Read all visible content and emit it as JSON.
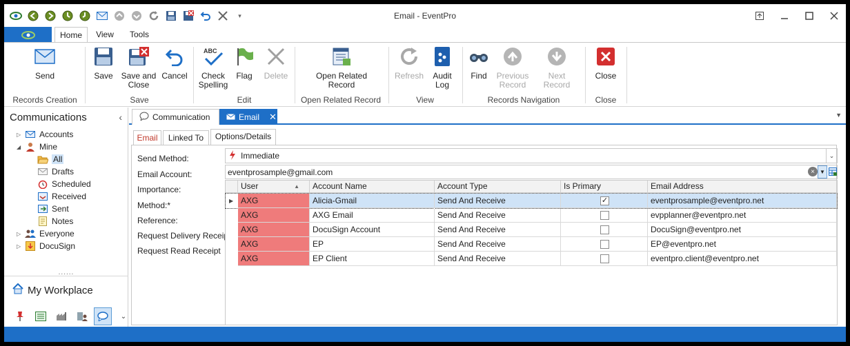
{
  "window": {
    "title": "Email - EventPro"
  },
  "qat": {
    "icons": [
      "logo-icon",
      "back-icon",
      "forward-icon",
      "home-icon",
      "clock-icon",
      "mail-icon",
      "up-icon",
      "down-icon",
      "refresh-icon",
      "save-icon",
      "save-close-icon",
      "undo-icon",
      "close-x-icon",
      "customize-icon"
    ]
  },
  "ribbon_tabs": {
    "home": "Home",
    "view": "View",
    "tools": "Tools"
  },
  "ribbon": {
    "send": "Send",
    "save": "Save",
    "save_close": "Save and Close",
    "cancel": "Cancel",
    "check_spelling": "Check Spelling",
    "flag": "Flag",
    "delete": "Delete",
    "open_related": "Open Related Record",
    "refresh": "Refresh",
    "audit_log": "Audit Log",
    "find": "Find",
    "prev_record": "Previous Record",
    "next_record": "Next Record",
    "close": "Close",
    "groups": {
      "records_creation": "Records Creation",
      "save": "Save",
      "edit": "Edit",
      "open_related": "Open Related Record",
      "view": "View",
      "records_nav": "Records Navigation",
      "close": "Close"
    }
  },
  "left_pane": {
    "header": "Communications",
    "tree": {
      "accounts": "Accounts",
      "mine": "Mine",
      "all": "All",
      "drafts": "Drafts",
      "scheduled": "Scheduled",
      "received": "Received",
      "sent": "Sent",
      "notes": "Notes",
      "everyone": "Everyone",
      "docusign": "DocuSign"
    },
    "grip": "......",
    "workplace": "My Workplace"
  },
  "doc_tabs": {
    "communication": "Communication",
    "email": "Email"
  },
  "inner_tabs": {
    "email": "Email",
    "linked_to": "Linked To",
    "options": "Options/Details"
  },
  "form": {
    "send_method_label": "Send Method:",
    "email_account_label": "Email Account:",
    "importance_label": "Importance:",
    "method_label": "Method:*",
    "reference_label": "Reference:",
    "req_delivery_label": "Request Delivery Receipt",
    "req_read_label": "Request Read Receipt",
    "send_method_value": "Immediate",
    "email_account_value": "eventprosample@gmail.com"
  },
  "grid": {
    "columns": [
      "User",
      "Account Name",
      "Account Type",
      "Is Primary",
      "Email Address"
    ],
    "rows": [
      {
        "user": "AXG",
        "account_name": "Alicia-Gmail",
        "account_type": "Send And Receive",
        "is_primary": true,
        "email": "eventprosample@eventpro.net"
      },
      {
        "user": "AXG",
        "account_name": "AXG Email",
        "account_type": "Send And Receive",
        "is_primary": false,
        "email": "evpplanner@eventpro.net"
      },
      {
        "user": "AXG",
        "account_name": "DocuSign Account",
        "account_type": "Send And Receive",
        "is_primary": false,
        "email": "DocuSign@eventpro.net"
      },
      {
        "user": "AXG",
        "account_name": "EP",
        "account_type": "Send And Receive",
        "is_primary": false,
        "email": "EP@eventpro.net"
      },
      {
        "user": "AXG",
        "account_name": "EP Client",
        "account_type": "Send And Receive",
        "is_primary": false,
        "email": "eventpro.client@eventpro.net"
      }
    ],
    "check_mark": "✓"
  },
  "colors": {
    "accent": "#1e6fc7",
    "user_cell": "#ef7b7b",
    "selection": "#cfe3f7"
  }
}
